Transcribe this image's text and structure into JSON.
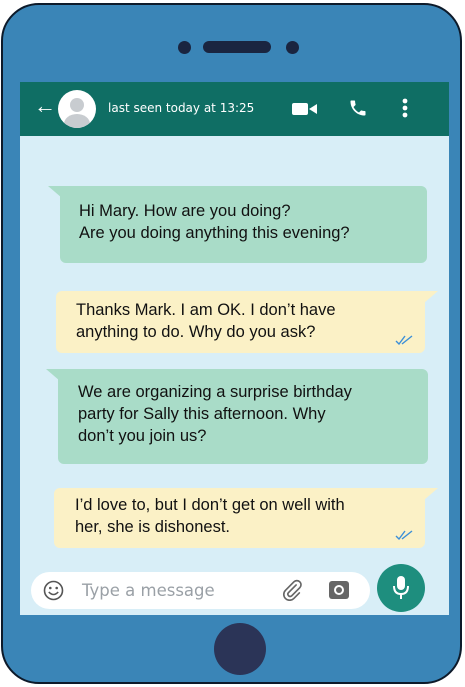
{
  "header": {
    "back_icon": "arrow-left-icon",
    "status": "last seen today at 13:25",
    "icons": [
      "video-call-icon",
      "phone-icon",
      "more-vertical-icon"
    ]
  },
  "messages": [
    {
      "sender": "outgoing",
      "color": "#a9dcc8",
      "lines": [
        "Hi Mary. How are you doing?",
        "Are you doing anything this evening?"
      ],
      "read_ticks": false
    },
    {
      "sender": "incoming",
      "color": "#fbf1c6",
      "lines": [
        "Thanks Mark. I am OK. I don’t have",
        "anything to do. Why do you ask?"
      ],
      "read_ticks": true
    },
    {
      "sender": "outgoing",
      "color": "#a9dcc8",
      "lines": [
        "We are organizing a surprise birthday",
        "party for Sally this afternoon. Why",
        "don’t you join us?"
      ],
      "read_ticks": false
    },
    {
      "sender": "incoming",
      "color": "#fbf1c6",
      "lines": [
        "I’d love to, but I don’t get on well with",
        "her, she is dishonest."
      ],
      "read_ticks": true
    }
  ],
  "composer": {
    "placeholder": "Type a message",
    "icons": [
      "emoji-icon",
      "attachment-icon",
      "camera-icon",
      "microphone-icon"
    ]
  },
  "colors": {
    "frame": "#3a85b7",
    "header": "#0f6e64",
    "screen": "#d8eef7",
    "mic": "#1e8e7e",
    "ticks": "#3b8fd8"
  }
}
